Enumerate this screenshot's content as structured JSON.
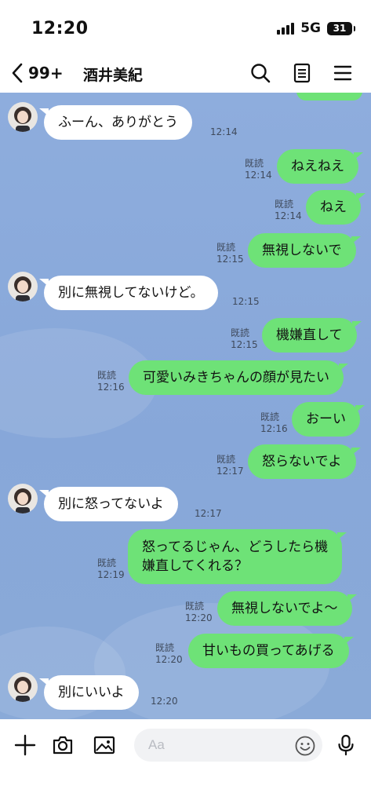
{
  "status": {
    "time": "12:20",
    "network": "5G",
    "battery": "31"
  },
  "header": {
    "unread_count": "99+",
    "title": "酒井美紀",
    "icons": [
      "chevron-left-icon",
      "search-icon",
      "notes-icon",
      "menu-icon"
    ]
  },
  "messages": [
    {
      "side": "in",
      "text": "ふーん、ありがとう",
      "time": "12:14"
    },
    {
      "side": "out",
      "text": "ねえねえ",
      "read": "既読",
      "time": "12:14"
    },
    {
      "side": "out",
      "text": "ねえ",
      "read": "既読",
      "time": "12:14"
    },
    {
      "side": "out",
      "text": "無視しないで",
      "read": "既読",
      "time": "12:15"
    },
    {
      "side": "in",
      "text": "別に無視してないけど。",
      "time": "12:15"
    },
    {
      "side": "out",
      "text": "機嫌直して",
      "read": "既読",
      "time": "12:15"
    },
    {
      "side": "out",
      "text": "可愛いみきちゃんの顔が見たい",
      "read": "既読",
      "time": "12:16"
    },
    {
      "side": "out",
      "text": "おーい",
      "read": "既読",
      "time": "12:16"
    },
    {
      "side": "out",
      "text": "怒らないでよ",
      "read": "既読",
      "time": "12:17"
    },
    {
      "side": "in",
      "text": "別に怒ってないよ",
      "time": "12:17"
    },
    {
      "side": "out",
      "lines": [
        "怒ってるじゃん、どうしたら機",
        "嫌直してくれる？"
      ],
      "read": "既読",
      "time": "12:19"
    },
    {
      "side": "out",
      "text": "無視しないでよ〜",
      "read": "既読",
      "time": "12:20"
    },
    {
      "side": "out",
      "text": "甘いもの買ってあげる",
      "read": "既読",
      "time": "12:20"
    },
    {
      "side": "in",
      "text": "別にいいよ",
      "time": "12:20"
    }
  ],
  "input": {
    "placeholder": "Aa"
  },
  "toolbar_icons": [
    "plus-icon",
    "camera-icon",
    "image-icon",
    "emoji-icon",
    "microphone-icon"
  ],
  "colors": {
    "chat_background": "#8aaad8",
    "outgoing_bubble": "#6ee277",
    "incoming_bubble": "#ffffff"
  }
}
